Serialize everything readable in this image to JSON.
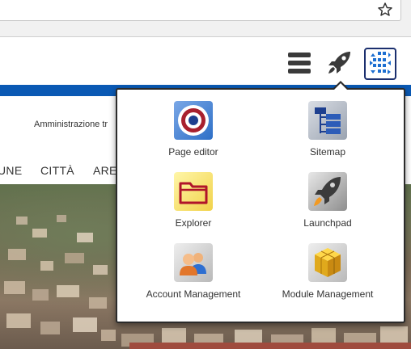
{
  "browser": {
    "star_icon": "bookmark-star-icon"
  },
  "header": {
    "menu_icon": "hamburger-icon",
    "rocket_icon": "rocket-icon",
    "apps_icon": "grid-apps-icon",
    "accent_color": "#0a59b4"
  },
  "page": {
    "admin_text": "Amministrazione tr",
    "nav": [
      "UNE",
      "CITTÀ",
      "ARE"
    ]
  },
  "dropdown": {
    "items": [
      {
        "label": "Page editor",
        "icon": "page-editor-icon"
      },
      {
        "label": "Sitemap",
        "icon": "sitemap-icon"
      },
      {
        "label": "Explorer",
        "icon": "folder-icon"
      },
      {
        "label": "Launchpad",
        "icon": "rocket-icon"
      },
      {
        "label": "Account Management",
        "icon": "users-icon"
      },
      {
        "label": "Module Management",
        "icon": "cube-icon"
      }
    ]
  }
}
